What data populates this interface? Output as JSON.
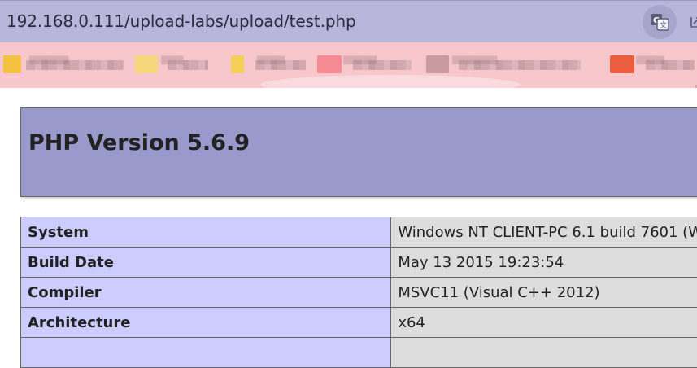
{
  "browser": {
    "url": "192.168.0.111/upload-labs/upload/test.php",
    "translate_icon": "translate-icon",
    "side_icon": "external-icon"
  },
  "bookmarks": [
    {
      "icon": "folder-icon",
      "color": "#f3c243",
      "label": "▒▒▒▒▒▒▒"
    },
    {
      "icon": "folder-icon",
      "color": "#f6d67a",
      "label": "▒▒▒▒"
    },
    {
      "icon": "folder-icon",
      "color": "#f6cf58",
      "label": "▒▒▒▒▒"
    },
    {
      "icon": "site-icon",
      "color": "#f48a92",
      "label": "▒▒▒▒▒▒"
    },
    {
      "icon": "site-icon",
      "color": "#c99aa2",
      "label": "▒▒▒▒▒▒▒▒"
    },
    {
      "icon": "site-icon",
      "color": "#ea5e3f",
      "label": "▒▒▒▒▒"
    }
  ],
  "phpinfo": {
    "title": "PHP Version 5.6.9",
    "rows": [
      {
        "key": "System",
        "value": "Windows NT CLIENT-PC 6.1 build 7601 (W"
      },
      {
        "key": "Build Date",
        "value": "May 13 2015 19:23:54"
      },
      {
        "key": "Compiler",
        "value": "MSVC11 (Visual C++ 2012)"
      },
      {
        "key": "Architecture",
        "value": "x64"
      },
      {
        "key": "",
        "value": ""
      }
    ]
  }
}
